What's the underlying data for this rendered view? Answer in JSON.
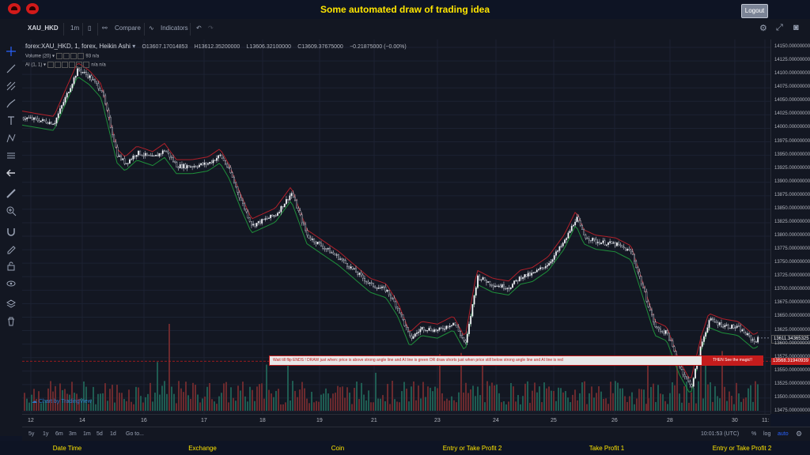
{
  "site": {
    "title": "Some automated draw of trading idea",
    "logout_label": "Logout"
  },
  "toolbar": {
    "symbol": "XAU_HKD",
    "interval": "1m",
    "compare_label": "Compare",
    "indicators_label": "Indicators"
  },
  "legend": {
    "main": "forex:XAU_HKD, 1, forex, Heikin Ashi",
    "open": "O13607.17014853",
    "high": "H13612.35200000",
    "low": "L13606.32100000",
    "close": "C13609.37675000",
    "change": "−0.21875000 (−0.00%)",
    "volume_label": "Volume (20)",
    "volume_vals": "93 n/a",
    "ai_label": "AI (1, 1)",
    "ai_vals": "n/a n/a"
  },
  "price_axis": {
    "labels": [
      "14150.00000000",
      "14125.00000000",
      "14100.00000000",
      "14075.00000000",
      "14050.00000000",
      "14025.00000000",
      "14000.00000000",
      "13975.00000000",
      "13950.00000000",
      "13925.00000000",
      "13900.00000000",
      "13875.00000000",
      "13850.00000000",
      "13825.00000000",
      "13800.00000000",
      "13775.00000000",
      "13750.00000000",
      "13725.00000000",
      "13700.00000000",
      "13675.00000000",
      "13650.00000000",
      "13625.00000000",
      "13600.00000000",
      "13575.00000000",
      "13550.00000000",
      "13525.00000000",
      "13500.00000000",
      "13475.00000000"
    ],
    "current_price": "13611.34365325",
    "marker_price": "13568.31940939"
  },
  "time_axis": {
    "labels": [
      "12",
      "14",
      "16",
      "17",
      "18",
      "19",
      "21",
      "23",
      "24",
      "25",
      "26",
      "28",
      "30",
      "11:"
    ]
  },
  "bottombar": {
    "ranges": [
      "5y",
      "1y",
      "6m",
      "3m",
      "1m",
      "5d",
      "1d"
    ],
    "goto": "Go to...",
    "clock": "10:01:53 (UTC)",
    "percent": "%",
    "log": "log",
    "auto": "auto"
  },
  "banner": {
    "text": "Wait till flip ENDS !   DRAW just when:  price is above strong angle line and AI line is green          OR          draw shorts just when price still below strong angle line and AI line is red",
    "magic": "THEN See the magic!!"
  },
  "watermark": "Chart by TradingView",
  "footer": [
    "Date Time",
    "Exchange",
    "Coin",
    "Entry or Take Profit 2",
    "Take Profit 1",
    "Entry or Take Profit 2"
  ],
  "colors": {
    "up": "#26a69a",
    "down": "#ef5350",
    "accent": "#ffe600",
    "candle_up": "#ffffff",
    "candle_down": "#d1d4dc"
  }
}
